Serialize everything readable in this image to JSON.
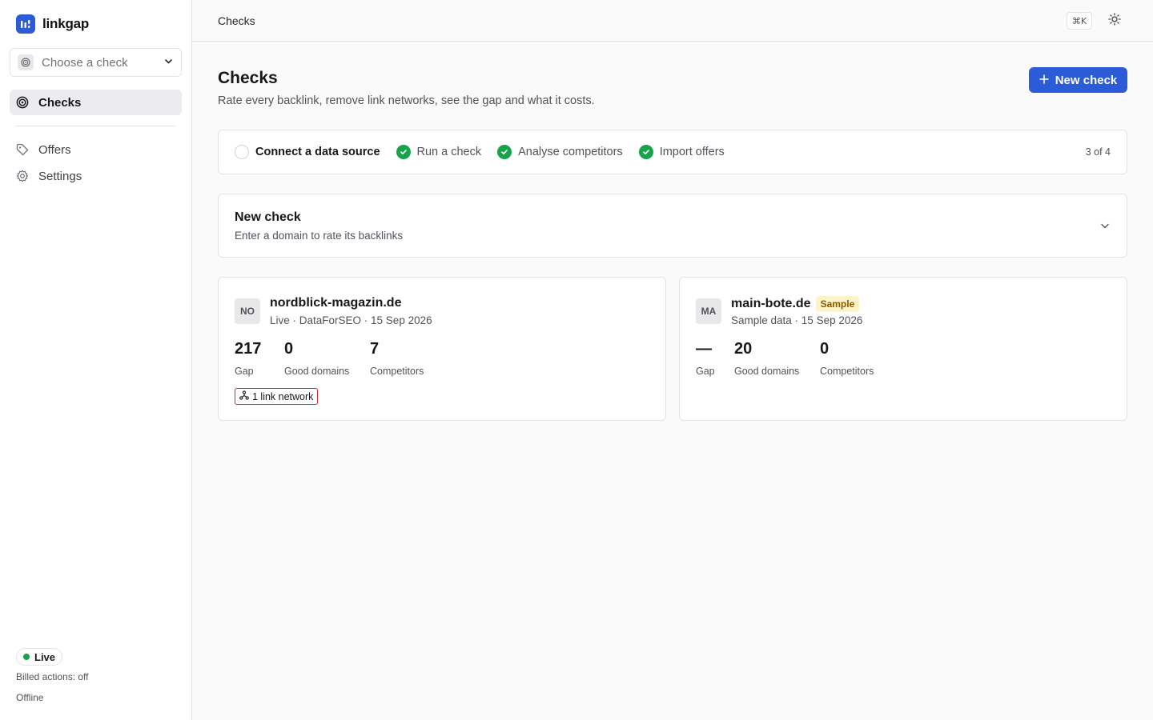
{
  "app": {
    "name": "linkgap"
  },
  "sidebar": {
    "check_select": {
      "placeholder": "Choose a check"
    },
    "nav": [
      {
        "label": "Checks",
        "icon": "target-icon",
        "active": true
      },
      {
        "label": "Offers",
        "icon": "tag-icon",
        "active": false
      },
      {
        "label": "Settings",
        "icon": "gear-icon",
        "active": false
      }
    ],
    "status": {
      "label": "Live",
      "color": "#16a34a"
    },
    "billed_actions": "Billed actions: off",
    "connection": "Offline"
  },
  "topbar": {
    "title": "Checks",
    "shortcut": "⌘K",
    "theme_icon": "sun-icon"
  },
  "main": {
    "title": "Checks",
    "subtitle": "Rate every backlink, remove link networks, see the gap and what it costs.",
    "new_check_button": "New check",
    "accent": "#2b5bd7",
    "steps": [
      {
        "label": "Connect a data source",
        "done": false,
        "current": true
      },
      {
        "label": "Run a check",
        "done": true,
        "current": false
      },
      {
        "label": "Analyse competitors",
        "done": true,
        "current": false
      },
      {
        "label": "Import offers",
        "done": true,
        "current": false
      }
    ],
    "steps_progress": "3 of 4",
    "new_check_panel": {
      "title": "New check",
      "subtitle": "Enter a domain to rate its backlinks"
    },
    "checks": [
      {
        "initials": "NO",
        "domain": "nordblick-magazin.de",
        "badge": "",
        "meta": "Live · DataForSEO · 15 Sep 2026",
        "stats": [
          {
            "value": "217",
            "label": "Gap"
          },
          {
            "value": "0",
            "label": "Good domains"
          },
          {
            "value": "7",
            "label": "Competitors"
          }
        ],
        "network_badge": "1 link network"
      },
      {
        "initials": "MA",
        "domain": "main-bote.de",
        "badge": "Sample",
        "meta": "Sample data · 15 Sep 2026",
        "stats": [
          {
            "value": "—",
            "label": "Gap"
          },
          {
            "value": "20",
            "label": "Good domains"
          },
          {
            "value": "0",
            "label": "Competitors"
          }
        ],
        "network_badge": ""
      }
    ]
  }
}
